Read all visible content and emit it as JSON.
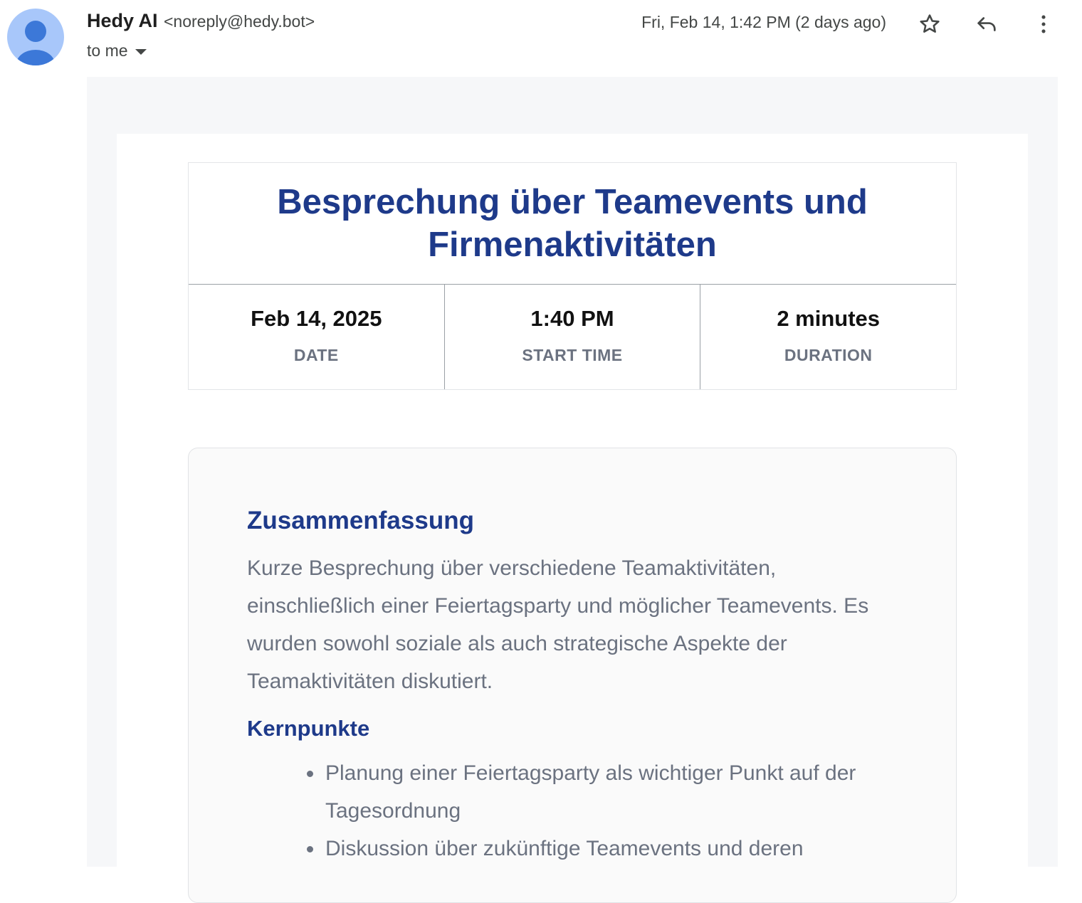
{
  "header": {
    "sender_name": "Hedy AI",
    "sender_email": "<noreply@hedy.bot>",
    "recipient": "to me",
    "timestamp": "Fri, Feb 14, 1:42 PM (2 days ago)",
    "icons": [
      "avatar-icon",
      "star-icon",
      "reply-icon",
      "more-vert-icon"
    ]
  },
  "meeting": {
    "title": "Besprechung über Teamevents und Firmenaktivitäten",
    "stats": [
      {
        "value": "Feb 14, 2025",
        "label": "DATE"
      },
      {
        "value": "1:40 PM",
        "label": "START TIME"
      },
      {
        "value": "2 minutes",
        "label": "DURATION"
      }
    ]
  },
  "summary": {
    "heading": "Zusammenfassung",
    "text": "Kurze Besprechung über verschiedene Teamaktivitäten, einschließlich einer Feiertagsparty und möglicher Teamevents. Es wurden sowohl soziale als auch strategische Aspekte der Teamaktivitäten diskutiert.",
    "key_points_heading": "Kernpunkte",
    "key_points": [
      "Planung einer Feiertagsparty als wichtiger Punkt auf der Tagesordnung",
      "Diskussion über zukünftige Teamevents und deren"
    ]
  },
  "colors": {
    "accent": "#1e3a8a",
    "muted_text": "#6b7280",
    "avatar_bg": "#a8c7fa",
    "avatar_fg": "#3c78d8"
  }
}
